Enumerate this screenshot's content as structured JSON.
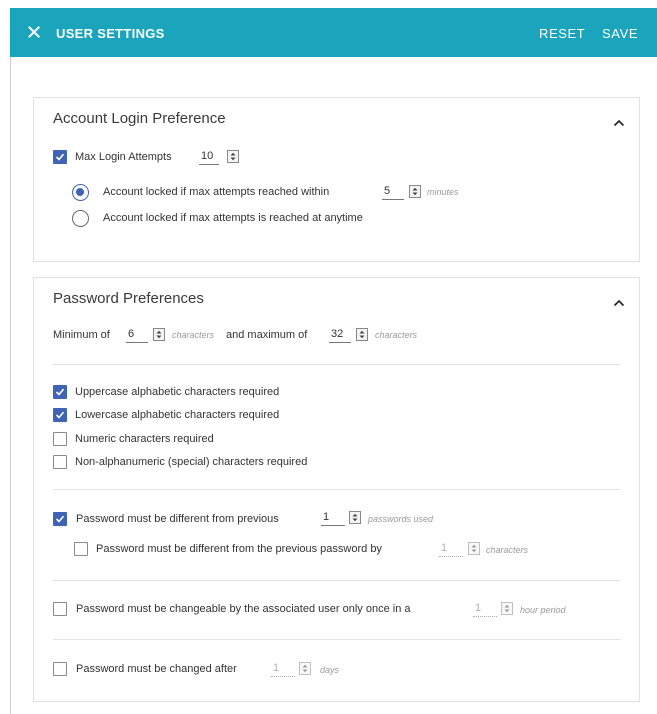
{
  "header": {
    "title": "USER SETTINGS",
    "reset_label": "RESET",
    "save_label": "SAVE",
    "background_color": "#1aa5bd",
    "close_icon": "close-icon"
  },
  "accent_color": "#3f63b5",
  "login": {
    "title": "Account Login Preference",
    "max_attempts": {
      "label": "Max Login Attempts",
      "checked": true,
      "value": "10"
    },
    "options": [
      {
        "label": "Account locked if max attempts reached within",
        "selected": true,
        "value": "5",
        "unit": "minutes"
      },
      {
        "label": "Account locked if max attempts is reached at anytime",
        "selected": false
      }
    ]
  },
  "password": {
    "title": "Password Preferences",
    "length": {
      "min_prefix": "Minimum of",
      "min_value": "6",
      "min_unit": "characters",
      "max_prefix": "and maximum of",
      "max_value": "32",
      "max_unit": "characters"
    },
    "requirements": [
      {
        "label": "Uppercase alphabetic characters required",
        "checked": true
      },
      {
        "label": "Lowercase alphabetic characters required",
        "checked": true
      },
      {
        "label": "Numeric characters required",
        "checked": false
      },
      {
        "label": "Non-alphanumeric (special) characters required",
        "checked": false
      }
    ],
    "different_previous": {
      "label": "Password must be different from previous",
      "checked": true,
      "value": "1",
      "unit": "passwords used"
    },
    "different_by": {
      "label": "Password must be different from the previous password by",
      "checked": false,
      "value": "1",
      "unit": "characters"
    },
    "changeable_once": {
      "label": "Password must be changeable by the associated user only once in a",
      "checked": false,
      "value": "1",
      "unit": "hour period"
    },
    "changed_after": {
      "label": "Password must be changed after",
      "checked": false,
      "value": "1",
      "unit": "days"
    }
  }
}
